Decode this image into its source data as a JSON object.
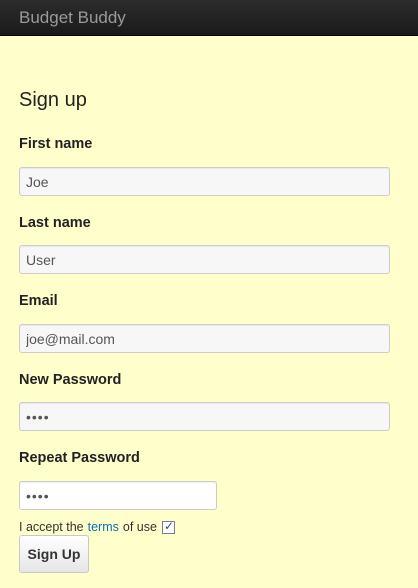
{
  "navbar": {
    "brand": "Budget Buddy"
  },
  "form": {
    "title": "Sign up",
    "first_name": {
      "label": "First name",
      "value": "Joe"
    },
    "last_name": {
      "label": "Last name",
      "value": "User"
    },
    "email": {
      "label": "Email",
      "value": "joe@mail.com"
    },
    "new_password": {
      "label": "New Password",
      "value": "••••"
    },
    "repeat_password": {
      "label": "Repeat Password",
      "value": "••••"
    },
    "terms": {
      "prefix": "I accept the",
      "link": "terms",
      "suffix": "of use",
      "checked": true
    },
    "submit_label": "Sign Up"
  },
  "colors": {
    "page_background": "#ffffcc",
    "navbar_background": "#1f1f1f",
    "brand_text": "#9a9a9a",
    "link": "#0a6fb6"
  }
}
